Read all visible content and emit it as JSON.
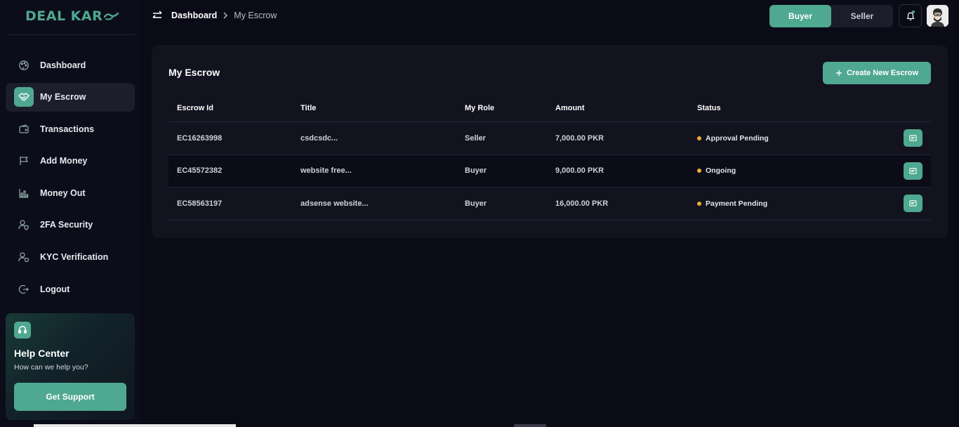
{
  "brand": {
    "logo_text": "DEAL KAR",
    "accent": "#4fa890"
  },
  "sidebar": {
    "items": [
      {
        "label": "Dashboard",
        "icon": "palette-icon"
      },
      {
        "label": "My Escrow",
        "icon": "handshake-icon",
        "active": true
      },
      {
        "label": "Transactions",
        "icon": "wallet-icon"
      },
      {
        "label": "Add Money",
        "icon": "flag-icon"
      },
      {
        "label": "Money Out",
        "icon": "chart-icon"
      },
      {
        "label": "2FA Security",
        "icon": "user-shield-icon"
      },
      {
        "label": "KYC Verification",
        "icon": "user-check-icon"
      },
      {
        "label": "Logout",
        "icon": "logout-icon"
      }
    ]
  },
  "help": {
    "title": "Help Center",
    "subtitle": "How can we help you?",
    "button": "Get Support"
  },
  "header": {
    "breadcrumb_root": "Dashboard",
    "breadcrumb_current": "My Escrow",
    "role_buyer": "Buyer",
    "role_seller": "Seller",
    "active_role": "Buyer"
  },
  "main": {
    "title": "My Escrow",
    "create_button": "Create New Escrow",
    "columns": [
      "Escrow Id",
      "Title",
      "My Role",
      "Amount",
      "Status"
    ],
    "rows": [
      {
        "id": "EC16263998",
        "title": "csdcsdc...",
        "role": "Seller",
        "amount": "7,000.00 PKR",
        "status": "Approval Pending"
      },
      {
        "id": "EC45572382",
        "title": "website free...",
        "role": "Buyer",
        "amount": "9,000.00 PKR",
        "status": "Ongoing"
      },
      {
        "id": "EC58563197",
        "title": "adsense website...",
        "role": "Buyer",
        "amount": "16,000.00 PKR",
        "status": "Payment Pending"
      }
    ],
    "status_color": "#f2a93b"
  }
}
